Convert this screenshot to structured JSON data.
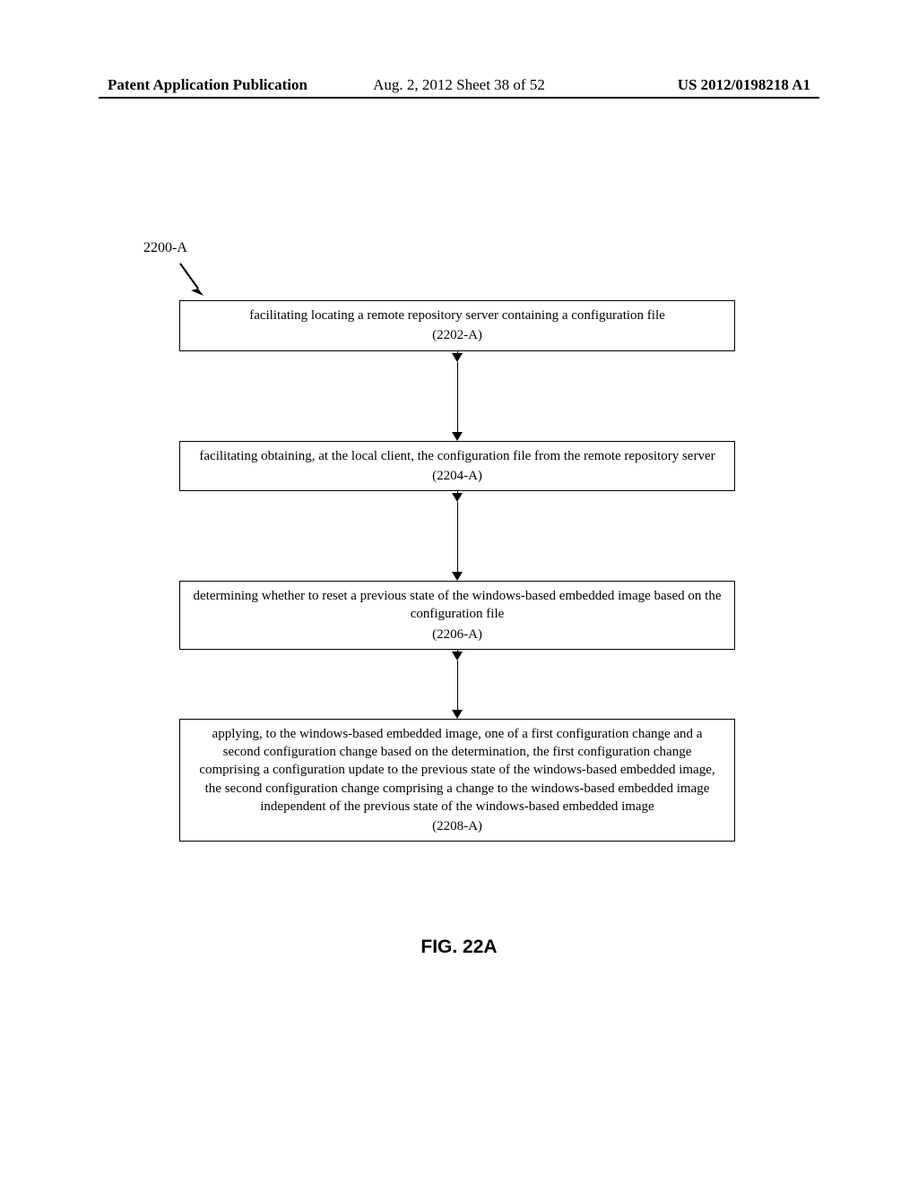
{
  "header": {
    "left": "Patent Application Publication",
    "center": "Aug. 2, 2012  Sheet 38 of 52",
    "right": "US 2012/0198218 A1"
  },
  "ref_label": "2200-A",
  "boxes": [
    {
      "text": "facilitating locating a remote repository server containing a configuration file",
      "ref": "(2202-A)"
    },
    {
      "text": "facilitating obtaining, at the local client, the configuration file from the remote repository server",
      "ref": "(2204-A)"
    },
    {
      "text": "determining whether to reset a previous state of the windows-based embedded image based on the configuration file",
      "ref": "(2206-A)"
    },
    {
      "text": "applying, to the windows-based embedded image, one of a first configuration change and a second configuration change based on the determination, the first configuration change comprising a configuration update to the previous state of the windows-based embedded image, the second configuration change comprising a change to the windows-based embedded image independent of the previous state of the windows-based embedded image",
      "ref": "(2208-A)"
    }
  ],
  "figure_caption": "FIG. 22A"
}
